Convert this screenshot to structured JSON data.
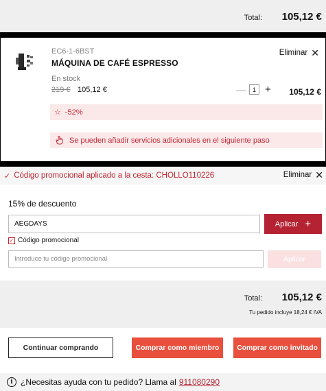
{
  "top_summary": {
    "total_label": "Total:",
    "total_value": "105,12 €"
  },
  "cart_item": {
    "sku": "EC6-1-6BST",
    "name": "MÁQUINA DE CAFÉ ESPRESSO",
    "remove_label": "Eliminar",
    "stock": "En stock",
    "old_price": "219 €",
    "new_price": "105,12 €",
    "quantity": "1",
    "line_total": "105,12 €",
    "discount_badge": "-52%",
    "services_note": "Se pueden añadir servicios adicionales en el siguiente paso"
  },
  "promo_applied": {
    "text": "Código promocional aplicado a la cesta: CHOLLO110226",
    "remove_label": "Eliminar"
  },
  "discount": {
    "title": "15% de descuento",
    "code_value": "AEGDAYS",
    "apply_label": "Aplicar",
    "checkbox_label": "Código promocional",
    "promo_placeholder": "Introduce tu código promocional",
    "apply2_label": "Aplicar"
  },
  "totals": {
    "label": "Total:",
    "value": "105,12 €",
    "iva_note": "Tu pedido incluye 18,24 € IVA"
  },
  "actions": {
    "continue": "Continuar comprando",
    "member": "Comprar como miembro",
    "guest": "Comprar como invitado"
  },
  "help": {
    "text": "¿Necesitas ayuda con tu pedido? Llama al",
    "phone": "911080290"
  },
  "colors": {
    "accent_red": "#b52232",
    "cta_orange": "#e84f3d",
    "promo_text": "#c4242f"
  }
}
